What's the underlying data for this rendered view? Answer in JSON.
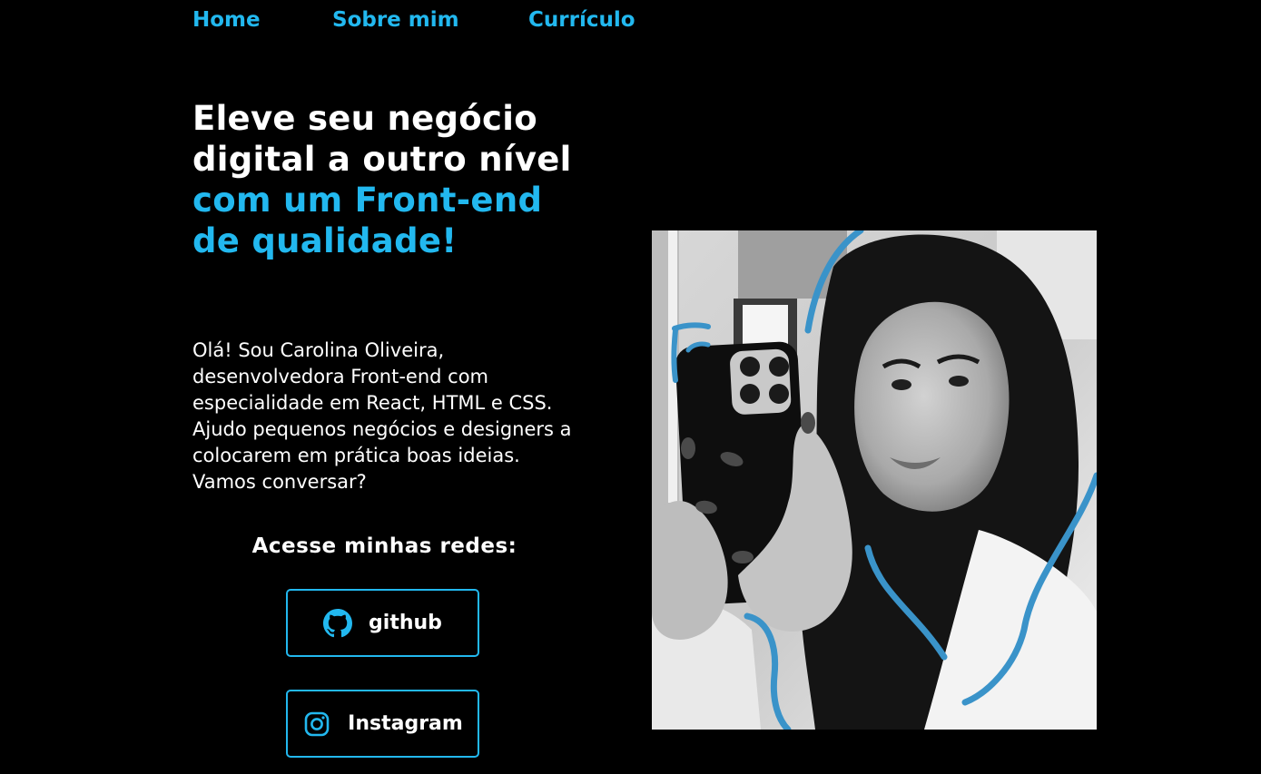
{
  "nav": {
    "items": [
      {
        "label": "Home"
      },
      {
        "label": "Sobre mim"
      },
      {
        "label": "Currículo"
      }
    ]
  },
  "hero": {
    "headline_white": "Eleve seu negócio digital a outro nível",
    "headline_accent": "com um Front-end de qualidade!",
    "intro": "Olá! Sou Carolina Oliveira, desenvolvedora Front-end com especialidade em React, HTML e CSS. Ajudo pequenos negócios e designers a colocarem em prática boas ideias. Vamos conversar?"
  },
  "networks": {
    "title": "Acesse minhas redes:",
    "github_label": "github",
    "instagram_label": "Instagram",
    "github_icon": "github-icon",
    "instagram_icon": "instagram-icon"
  },
  "photo": {
    "subject": "mirror-selfie-portrait"
  },
  "colors": {
    "background": "#000000",
    "accent": "#22b8ef",
    "text": "#ffffff",
    "photo_stroke": "#3a93c9"
  }
}
